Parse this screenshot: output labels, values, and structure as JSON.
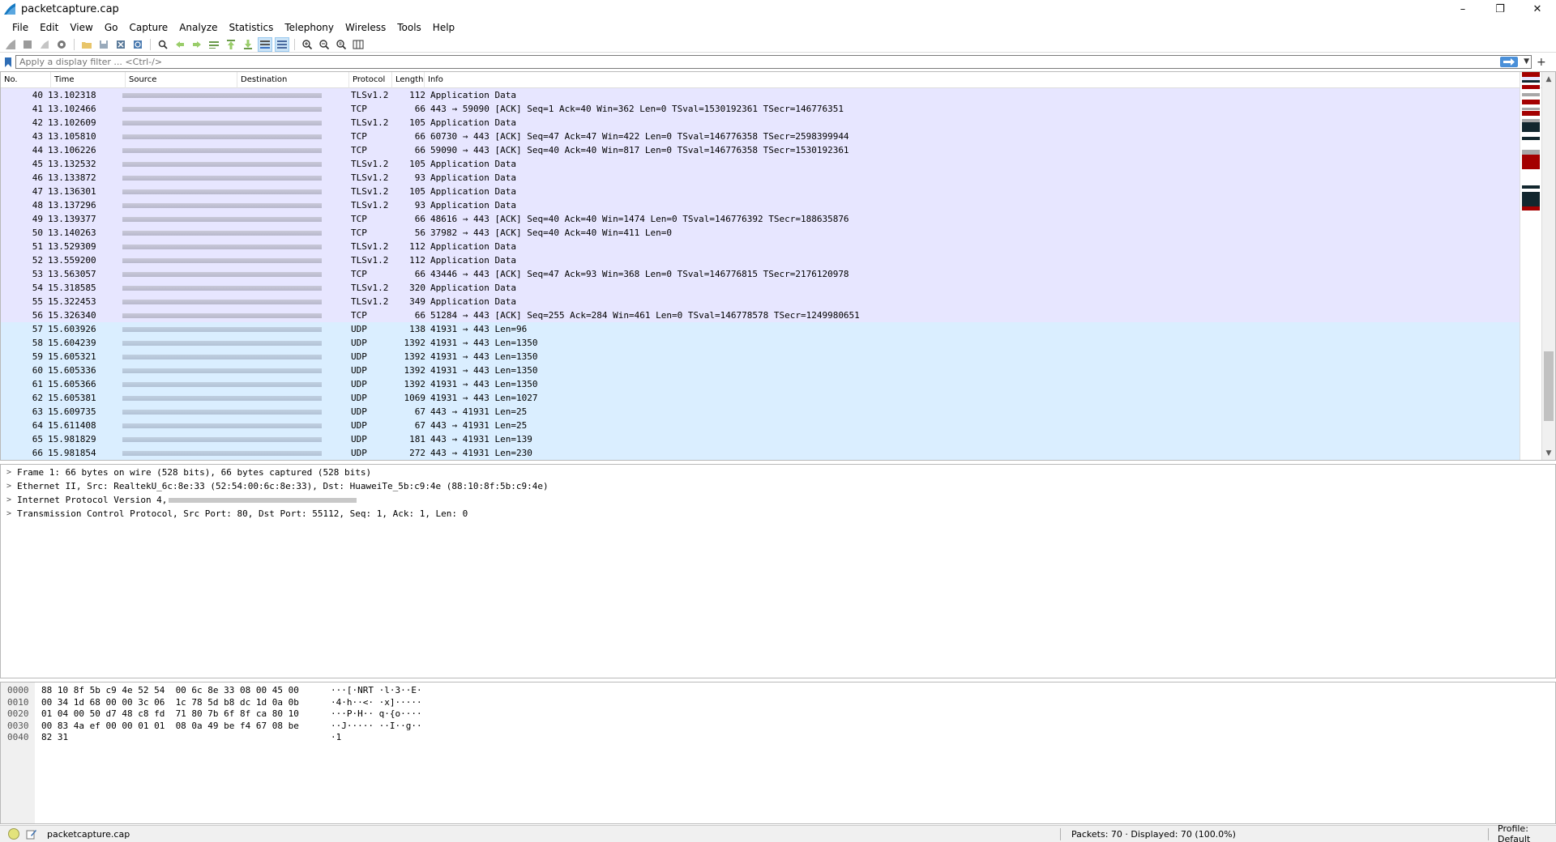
{
  "window": {
    "title": "packetcapture.cap",
    "minimize_glyph": "–",
    "maximize_glyph": "❐",
    "close_glyph": "✕"
  },
  "menu": [
    "File",
    "Edit",
    "View",
    "Go",
    "Capture",
    "Analyze",
    "Statistics",
    "Telephony",
    "Wireless",
    "Tools",
    "Help"
  ],
  "filter": {
    "placeholder": "Apply a display filter ... <Ctrl-/>",
    "add_glyph": "+"
  },
  "packet_list": {
    "columns": [
      "No.",
      "Time",
      "Source",
      "Destination",
      "Protocol",
      "Length",
      "Info"
    ],
    "rows": [
      {
        "no": "40",
        "time": "13.102318",
        "proto": "TLSv1.2",
        "len": "112",
        "info": "Application Data",
        "kind": "tcp"
      },
      {
        "no": "41",
        "time": "13.102466",
        "proto": "TCP",
        "len": "66",
        "info": "443 → 59090 [ACK] Seq=1 Ack=40 Win=362 Len=0 TSval=1530192361 TSecr=146776351",
        "kind": "tcp"
      },
      {
        "no": "42",
        "time": "13.102609",
        "proto": "TLSv1.2",
        "len": "105",
        "info": "Application Data",
        "kind": "tcp"
      },
      {
        "no": "43",
        "time": "13.105810",
        "proto": "TCP",
        "len": "66",
        "info": "60730 → 443 [ACK] Seq=47 Ack=47 Win=422 Len=0 TSval=146776358 TSecr=2598399944",
        "kind": "tcp"
      },
      {
        "no": "44",
        "time": "13.106226",
        "proto": "TCP",
        "len": "66",
        "info": "59090 → 443 [ACK] Seq=40 Ack=40 Win=817 Len=0 TSval=146776358 TSecr=1530192361",
        "kind": "tcp"
      },
      {
        "no": "45",
        "time": "13.132532",
        "proto": "TLSv1.2",
        "len": "105",
        "info": "Application Data",
        "kind": "tcp"
      },
      {
        "no": "46",
        "time": "13.133872",
        "proto": "TLSv1.2",
        "len": "93",
        "info": "Application Data",
        "kind": "tcp"
      },
      {
        "no": "47",
        "time": "13.136301",
        "proto": "TLSv1.2",
        "len": "105",
        "info": "Application Data",
        "kind": "tcp"
      },
      {
        "no": "48",
        "time": "13.137296",
        "proto": "TLSv1.2",
        "len": "93",
        "info": "Application Data",
        "kind": "tcp"
      },
      {
        "no": "49",
        "time": "13.139377",
        "proto": "TCP",
        "len": "66",
        "info": "48616 → 443 [ACK] Seq=40 Ack=40 Win=1474 Len=0 TSval=146776392 TSecr=188635876",
        "kind": "tcp"
      },
      {
        "no": "50",
        "time": "13.140263",
        "proto": "TCP",
        "len": "56",
        "info": "37982 → 443 [ACK] Seq=40 Ack=40 Win=411 Len=0",
        "kind": "tcp"
      },
      {
        "no": "51",
        "time": "13.529309",
        "proto": "TLSv1.2",
        "len": "112",
        "info": "Application Data",
        "kind": "tcp"
      },
      {
        "no": "52",
        "time": "13.559200",
        "proto": "TLSv1.2",
        "len": "112",
        "info": "Application Data",
        "kind": "tcp"
      },
      {
        "no": "53",
        "time": "13.563057",
        "proto": "TCP",
        "len": "66",
        "info": "43446 → 443 [ACK] Seq=47 Ack=93 Win=368 Len=0 TSval=146776815 TSecr=2176120978",
        "kind": "tcp"
      },
      {
        "no": "54",
        "time": "15.318585",
        "proto": "TLSv1.2",
        "len": "320",
        "info": "Application Data",
        "kind": "tcp"
      },
      {
        "no": "55",
        "time": "15.322453",
        "proto": "TLSv1.2",
        "len": "349",
        "info": "Application Data",
        "kind": "tcp"
      },
      {
        "no": "56",
        "time": "15.326340",
        "proto": "TCP",
        "len": "66",
        "info": "51284 → 443 [ACK] Seq=255 Ack=284 Win=461 Len=0 TSval=146778578 TSecr=1249980651",
        "kind": "tcp"
      },
      {
        "no": "57",
        "time": "15.603926",
        "proto": "UDP",
        "len": "138",
        "info": "41931 → 443 Len=96",
        "kind": "udp"
      },
      {
        "no": "58",
        "time": "15.604239",
        "proto": "UDP",
        "len": "1392",
        "info": "41931 → 443 Len=1350",
        "kind": "udp"
      },
      {
        "no": "59",
        "time": "15.605321",
        "proto": "UDP",
        "len": "1392",
        "info": "41931 → 443 Len=1350",
        "kind": "udp"
      },
      {
        "no": "60",
        "time": "15.605336",
        "proto": "UDP",
        "len": "1392",
        "info": "41931 → 443 Len=1350",
        "kind": "udp"
      },
      {
        "no": "61",
        "time": "15.605366",
        "proto": "UDP",
        "len": "1392",
        "info": "41931 → 443 Len=1350",
        "kind": "udp"
      },
      {
        "no": "62",
        "time": "15.605381",
        "proto": "UDP",
        "len": "1069",
        "info": "41931 → 443 Len=1027",
        "kind": "udp"
      },
      {
        "no": "63",
        "time": "15.609735",
        "proto": "UDP",
        "len": "67",
        "info": "443 → 41931 Len=25",
        "kind": "udp"
      },
      {
        "no": "64",
        "time": "15.611408",
        "proto": "UDP",
        "len": "67",
        "info": "443 → 41931 Len=25",
        "kind": "udp"
      },
      {
        "no": "65",
        "time": "15.981829",
        "proto": "UDP",
        "len": "181",
        "info": "443 → 41931 Len=139",
        "kind": "udp"
      },
      {
        "no": "66",
        "time": "15.981854",
        "proto": "UDP",
        "len": "272",
        "info": "443 → 41931 Len=230",
        "kind": "udp"
      }
    ]
  },
  "details": [
    {
      "text": "Frame 1: 66 bytes on wire (528 bits), 66 bytes captured (528 bits)",
      "redacted": false
    },
    {
      "text": "Ethernet II, Src: RealtekU_6c:8e:33 (52:54:00:6c:8e:33), Dst: HuaweiTe_5b:c9:4e (88:10:8f:5b:c9:4e)",
      "redacted": false
    },
    {
      "text": "Internet Protocol Version 4,",
      "redacted": true
    },
    {
      "text": "Transmission Control Protocol, Src Port: 80, Dst Port: 55112, Seq: 1, Ack: 1, Len: 0",
      "redacted": false
    }
  ],
  "bytes": [
    {
      "offset": "0000",
      "hex": "88 10 8f 5b c9 4e 52 54  00 6c 8e 33 08 00 45 00",
      "ascii": "···[·NRT ·l·3··E·"
    },
    {
      "offset": "0010",
      "hex": "00 34 1d 68 00 00 3c 06  1c 78 5d b8 dc 1d 0a 0b",
      "ascii": "·4·h··<· ·x]·····"
    },
    {
      "offset": "0020",
      "hex": "01 04 00 50 d7 48 c8 fd  71 80 7b 6f 8f ca 80 10",
      "ascii": "···P·H·· q·{o····"
    },
    {
      "offset": "0030",
      "hex": "00 83 4a ef 00 00 01 01  08 0a 49 be f4 67 08 be",
      "ascii": "··J····· ··I··g··"
    },
    {
      "offset": "0040",
      "hex": "82 31",
      "ascii": "·1"
    }
  ],
  "status": {
    "file": "packetcapture.cap",
    "packets": "Packets: 70 · Displayed: 70 (100.0%)",
    "profile": "Profile: Default"
  },
  "colors": {
    "tcp_row": "#e7e6ff",
    "udp_row": "#daeeff",
    "minimap_red": "#a40000",
    "minimap_dark": "#12272e",
    "minimap_lavender": "#e7e6ff"
  }
}
